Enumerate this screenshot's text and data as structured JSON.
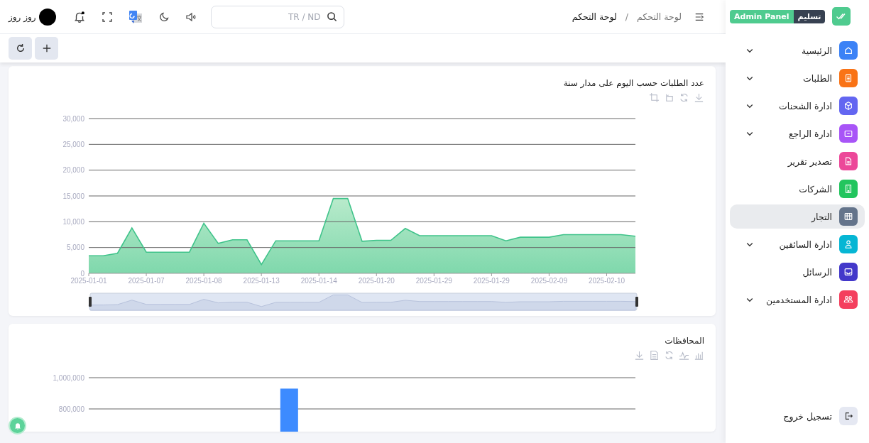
{
  "topbar": {
    "user_name": "روز روز",
    "search": {
      "placeholder": "TR / ND"
    },
    "breadcrumbs": [
      {
        "label": "لوحة التحكم",
        "current": false
      },
      {
        "label": "لوحة التحكم",
        "current": true
      }
    ],
    "separator": "/"
  },
  "sidebar": {
    "brand": {
      "name": "تسليم",
      "tag": "Admin Panel"
    },
    "items": [
      {
        "label": "الرئيسية",
        "color": "#3b82f6",
        "expandable": true,
        "selected": false
      },
      {
        "label": "الطلبات",
        "color": "#f97316",
        "expandable": true,
        "selected": false
      },
      {
        "label": "ادارة الشحنات",
        "color": "#6366f1",
        "expandable": true,
        "selected": false
      },
      {
        "label": "ادارة الراجع",
        "color": "#a855f7",
        "expandable": true,
        "selected": false
      },
      {
        "label": "تصدير تقرير",
        "color": "#ec4899",
        "expandable": false,
        "selected": false
      },
      {
        "label": "الشركات",
        "color": "#22c55e",
        "expandable": false,
        "selected": false
      },
      {
        "label": "التجار",
        "color": "#64748b",
        "expandable": false,
        "selected": true
      },
      {
        "label": "ادارة السائقين",
        "color": "#06b6d4",
        "expandable": true,
        "selected": false
      },
      {
        "label": "الرسائل",
        "color": "#4338ca",
        "expandable": false,
        "selected": false
      },
      {
        "label": "ادارة المستخدمين",
        "color": "#f43f5e",
        "expandable": true,
        "selected": false
      }
    ],
    "logout": "تسجيل خروج"
  },
  "charts": [
    {
      "title": "عدد الطلبات حسب اليوم على مدار سنة",
      "chart_data": {
        "type": "area",
        "values": [
          3400,
          3400,
          3900,
          8800,
          4100,
          4100,
          4100,
          4100,
          9700,
          5800,
          6500,
          6500,
          1700,
          6300,
          6300,
          6300,
          6300,
          14500,
          14500,
          6200,
          6400,
          6400,
          8700,
          7300,
          7300,
          7300,
          7300,
          7300,
          7300,
          6300,
          7000,
          7000,
          7000,
          7500,
          7500,
          7500,
          7500,
          7500,
          7200
        ],
        "ylim": [
          0,
          30000
        ],
        "grid": true,
        "yticks": [
          {
            "value": 0,
            "label": "0"
          },
          {
            "value": 5000,
            "label": "5,000"
          },
          {
            "value": 10000,
            "label": "10,000"
          },
          {
            "value": 15000,
            "label": "15,000"
          },
          {
            "value": 20000,
            "label": "20,000"
          },
          {
            "value": 25000,
            "label": "25,000"
          },
          {
            "value": 30000,
            "label": "30,000"
          }
        ],
        "categories": [
          "2025-01-01",
          null,
          null,
          null,
          "2025-01-07",
          null,
          null,
          null,
          "2025-01-08",
          null,
          null,
          null,
          "2025-01-13",
          null,
          null,
          null,
          "2025-01-14",
          null,
          null,
          null,
          "2025-01-20",
          null,
          null,
          null,
          "2025-01-29",
          null,
          null,
          null,
          "2025-01-29",
          null,
          null,
          null,
          "2025-02-09",
          null,
          null,
          null,
          "2025-02-10",
          null,
          null
        ]
      }
    },
    {
      "title": "المحافظات",
      "chart_data": {
        "type": "bar",
        "values": [
          null,
          null,
          null,
          null,
          null,
          930000,
          null,
          null,
          null,
          null,
          null,
          null,
          null,
          null,
          null
        ],
        "ylim": [
          0,
          1000000
        ],
        "grid": true,
        "yticks": [
          {
            "value": 800000,
            "label": "800,000"
          },
          {
            "value": 1000000,
            "label": "1,000,000"
          }
        ]
      }
    }
  ]
}
